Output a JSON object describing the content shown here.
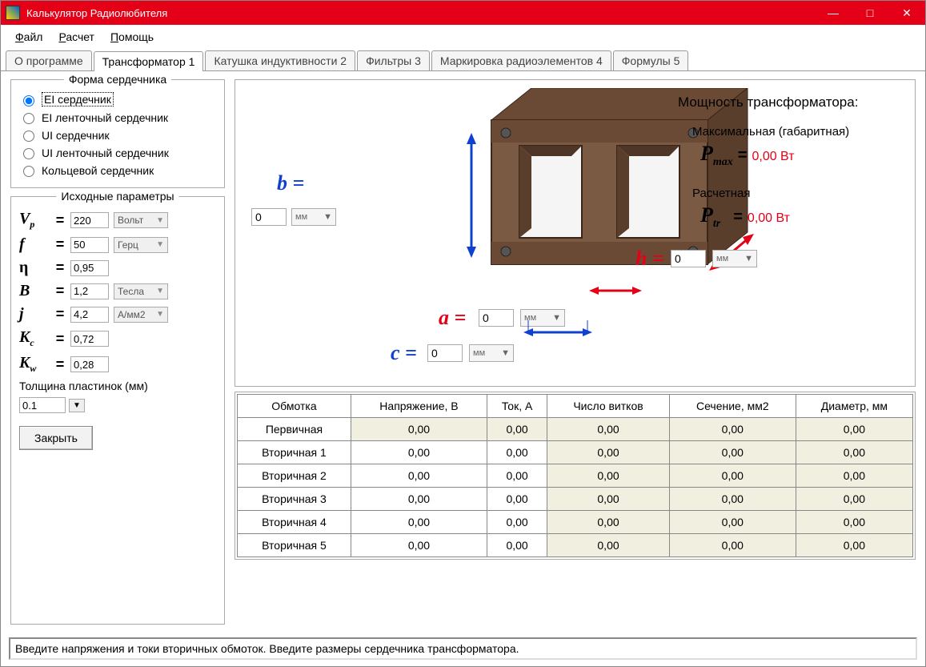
{
  "titlebar": {
    "title": "Калькулятор Радиолюбителя"
  },
  "menu": {
    "file": "Файл",
    "calc": "Расчет",
    "help": "Помощь"
  },
  "tabs": [
    {
      "label": "О программе"
    },
    {
      "label": "Трансформатор 1"
    },
    {
      "label": "Катушка индуктивности 2"
    },
    {
      "label": "Фильтры 3"
    },
    {
      "label": "Маркировка радиоэлементов 4"
    },
    {
      "label": "Формулы 5"
    }
  ],
  "core_shape": {
    "title": "Форма сердечника",
    "options": [
      "EI сердечник",
      "EI ленточный сердечник",
      "UI сердечник",
      "UI ленточный сердечник",
      "Кольцевой сердечник"
    ]
  },
  "params": {
    "title": "Исходные параметры",
    "Vp": {
      "val": "220",
      "unit": "Вольт"
    },
    "f": {
      "val": "50",
      "unit": "Герц"
    },
    "eta": {
      "val": "0,95"
    },
    "B": {
      "val": "1,2",
      "unit": "Тесла"
    },
    "j": {
      "val": "4,2",
      "unit": "А/мм2"
    },
    "Kc": {
      "val": "0,72"
    },
    "Kw": {
      "val": "0,28"
    }
  },
  "plate": {
    "label": "Толщина пластинок (мм)",
    "val": "0.1"
  },
  "close": "Закрыть",
  "dims": {
    "b": {
      "val": "0",
      "unit": "мм"
    },
    "a": {
      "val": "0",
      "unit": "мм"
    },
    "c": {
      "val": "0",
      "unit": "мм"
    },
    "h": {
      "val": "0",
      "unit": "мм"
    }
  },
  "power": {
    "title": "Мощность трансформатора:",
    "max_label": "Максимальная (габаритная)",
    "max_val": "0,00 Вт",
    "tr_label": "Расчетная",
    "tr_val": "0,00 Вт"
  },
  "table": {
    "headers": [
      "Обмотка",
      "Напряжение, В",
      "Ток, А",
      "Число витков",
      "Сечение, мм2",
      "Диаметр, мм"
    ],
    "rows": [
      {
        "name": "Первичная",
        "v": "0,00",
        "i": "0,00",
        "n": "0,00",
        "s": "0,00",
        "d": "0,00",
        "primary": true
      },
      {
        "name": "Вторичная 1",
        "v": "0,00",
        "i": "0,00",
        "n": "0,00",
        "s": "0,00",
        "d": "0,00"
      },
      {
        "name": "Вторичная 2",
        "v": "0,00",
        "i": "0,00",
        "n": "0,00",
        "s": "0,00",
        "d": "0,00"
      },
      {
        "name": "Вторичная 3",
        "v": "0,00",
        "i": "0,00",
        "n": "0,00",
        "s": "0,00",
        "d": "0,00"
      },
      {
        "name": "Вторичная 4",
        "v": "0,00",
        "i": "0,00",
        "n": "0,00",
        "s": "0,00",
        "d": "0,00"
      },
      {
        "name": "Вторичная 5",
        "v": "0,00",
        "i": "0,00",
        "n": "0,00",
        "s": "0,00",
        "d": "0,00"
      }
    ]
  },
  "status": "Введите напряжения и токи вторичных обмоток. Введите размеры сердечника трансформатора."
}
